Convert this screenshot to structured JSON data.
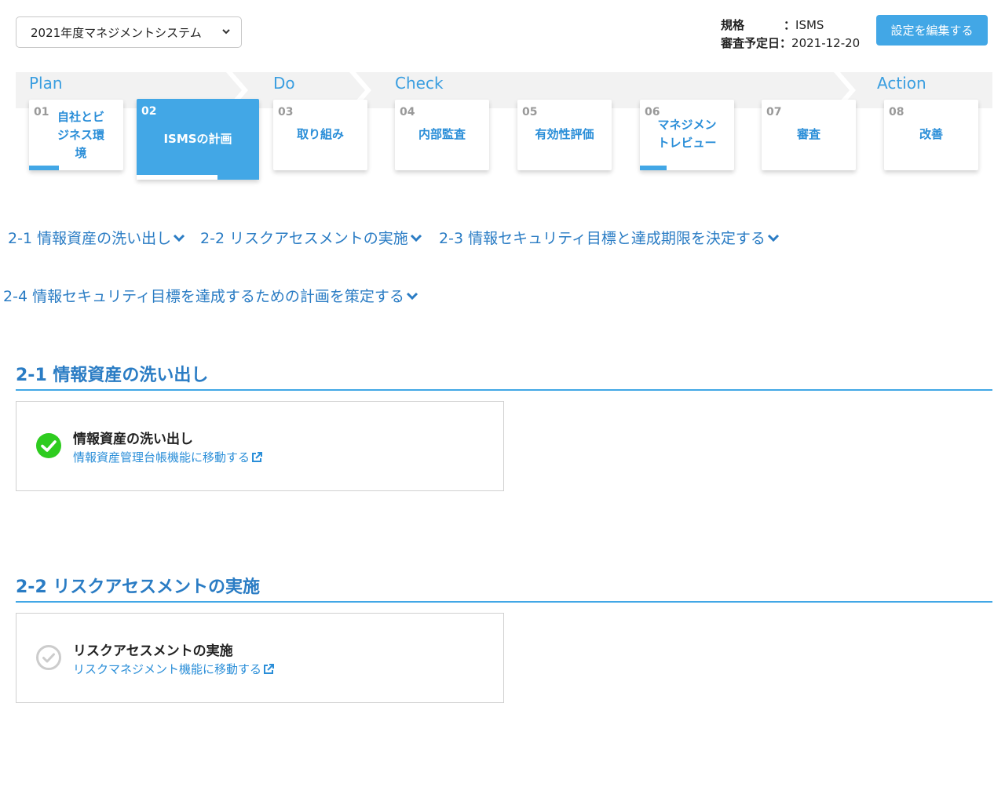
{
  "system_select": {
    "value": "2021年度マネジメントシステム"
  },
  "meta": {
    "standard_key": "規格",
    "standard_sep": "：",
    "standard_value": "ISMS",
    "audit_key": "審査予定日",
    "audit_sep": "：",
    "audit_value": "2021-12-20"
  },
  "edit_button": {
    "label": "設定を編集する"
  },
  "phases": [
    "Plan",
    "Do",
    "Check",
    "Action"
  ],
  "steps": [
    {
      "num": "01",
      "label": "自社とビジネス環境",
      "progress": 0.32
    },
    {
      "num": "02",
      "label": "ISMSの計画",
      "progress": 0.66,
      "active": true
    },
    {
      "num": "03",
      "label": "取り組み",
      "progress": 0
    },
    {
      "num": "04",
      "label": "内部監査",
      "progress": 0
    },
    {
      "num": "05",
      "label": "有効性評価",
      "progress": 0
    },
    {
      "num": "06",
      "label": "マネジメントレビュー",
      "progress": 0.28
    },
    {
      "num": "07",
      "label": "審査",
      "progress": 0
    },
    {
      "num": "08",
      "label": "改善",
      "progress": 0
    }
  ],
  "anchors": [
    "2-1 情報資産の洗い出し",
    "2-2 リスクアセスメントの実施",
    "2-3 情報セキュリティ目標と達成期限を決定する",
    "2-4 情報セキュリティ目標を達成するための計画を策定する"
  ],
  "sections": [
    {
      "title": "2-1 情報資産の洗い出し",
      "task_title": "情報資産の洗い出し",
      "task_link": "情報資産管理台帳機能に移動する",
      "status": "complete",
      "status_color": "#2ecc1f"
    },
    {
      "title": "2-2 リスクアセスメントの実施",
      "task_title": "リスクアセスメントの実施",
      "task_link": "リスクマネジメント機能に移動する",
      "status": "incomplete",
      "status_color": "#cccccc"
    }
  ],
  "colors": {
    "accent": "#42a7e6",
    "link": "#2a7cc4",
    "band": "#f2f2f2"
  }
}
